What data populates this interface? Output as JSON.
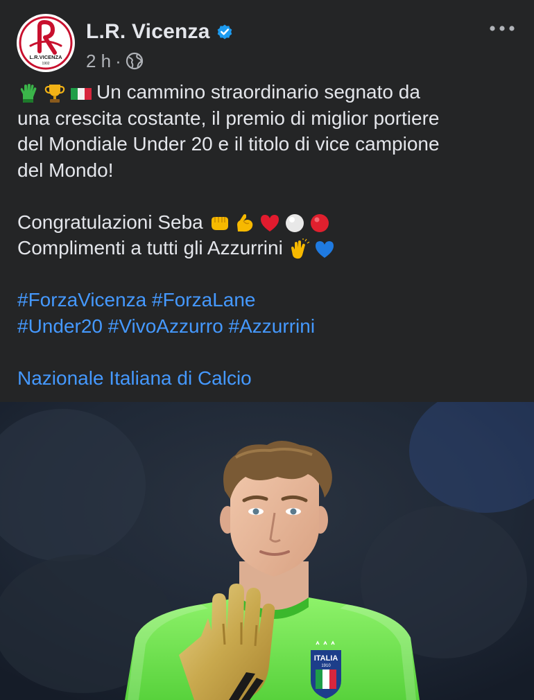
{
  "post": {
    "page_name": "L.R. Vicenza",
    "logo_text": "L.R.VICENZA",
    "logo_year": "1902",
    "time": "2 h",
    "separator": "·",
    "text_lines": [
      "Un cammino straordinario segnato da",
      "una crescita costante, il premio di miglior portiere",
      "del Mondiale Under 20 e il titolo di vice campione",
      "del Mondo!"
    ],
    "congrats": "Congratulazioni Seba",
    "compliments": "Complimenti a tutti gli Azzurrini",
    "hashtags": [
      [
        "#ForzaVicenza",
        "#ForzaLane"
      ],
      [
        "#Under20",
        "#VivoAzzurro",
        "#Azzurrini"
      ]
    ],
    "mention": "Nazionale Italiana di Calcio",
    "shirt_text": "ITALIA",
    "shirt_year": "1910"
  },
  "icons": {
    "first_line": [
      "glove-icon",
      "trophy-icon",
      "italy-flag-icon"
    ],
    "congrats": [
      "fist-icon",
      "flexed-biceps-icon",
      "red-heart-icon",
      "white-circle-icon",
      "red-circle-icon"
    ],
    "compliments": [
      "clapping-hands-icon",
      "blue-heart-icon"
    ]
  },
  "colors": {
    "background": "#242526",
    "text": "#e4e6eb",
    "secondary": "#b0b3b8",
    "link": "#4599ff",
    "verified": "#1d9bf0",
    "logo_red": "#c8102e"
  }
}
